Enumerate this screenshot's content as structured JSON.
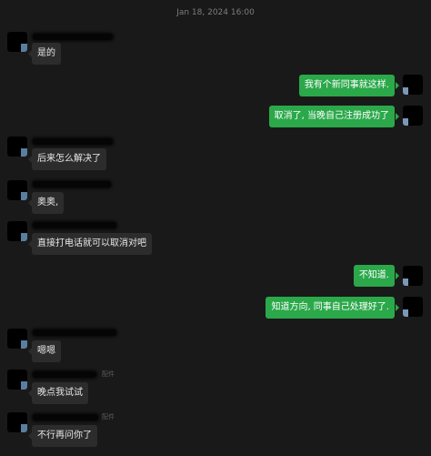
{
  "timestamp": "Jan 18, 2024 16:00",
  "messages": [
    {
      "dir": "in",
      "text": "是的",
      "sender_suffix": ""
    },
    {
      "dir": "out",
      "text": "我有个新同事就这样."
    },
    {
      "dir": "out",
      "text": "取消了, 当晚自己注册成功了"
    },
    {
      "dir": "in",
      "text": "后来怎么解决了",
      "sender_suffix": ""
    },
    {
      "dir": "in",
      "text": "奥奥,",
      "sender_suffix": ""
    },
    {
      "dir": "in",
      "text": "直接打电话就可以取消对吧",
      "sender_suffix": ""
    },
    {
      "dir": "out",
      "text": "不知道."
    },
    {
      "dir": "out",
      "text": "知道方向, 同事自己处理好了."
    },
    {
      "dir": "in",
      "text": "嗯嗯",
      "sender_suffix": ""
    },
    {
      "dir": "in",
      "text": "晚点我试试",
      "sender_suffix": "配件"
    },
    {
      "dir": "in",
      "text": "不行再问你了",
      "sender_suffix": "配件"
    }
  ],
  "colors": {
    "background": "#191919",
    "incoming_bubble": "#2c2c2c",
    "outgoing_bubble": "#2ba84a"
  }
}
